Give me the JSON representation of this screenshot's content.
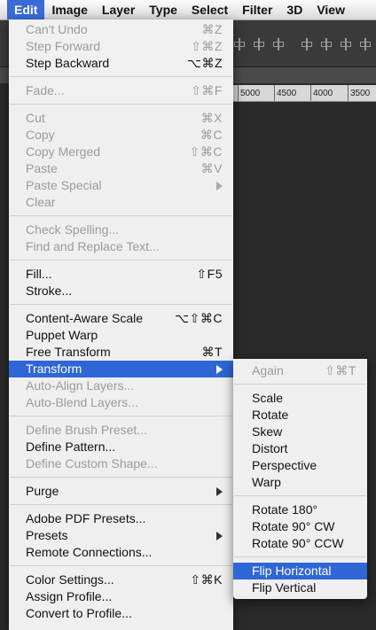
{
  "menubar": {
    "items": [
      {
        "label": "Edit",
        "active": true
      },
      {
        "label": "Image"
      },
      {
        "label": "Layer"
      },
      {
        "label": "Type"
      },
      {
        "label": "Select"
      },
      {
        "label": "Filter"
      },
      {
        "label": "3D"
      },
      {
        "label": "View"
      }
    ]
  },
  "ruler": {
    "marks": [
      "5000",
      "4500",
      "4000",
      "3500"
    ]
  },
  "edit_menu": {
    "groups": [
      [
        {
          "label": "Can't Undo",
          "shortcut": "⌘Z",
          "disabled": true
        },
        {
          "label": "Step Forward",
          "shortcut": "⇧⌘Z",
          "disabled": true
        },
        {
          "label": "Step Backward",
          "shortcut": "⌥⌘Z",
          "disabled": false
        }
      ],
      [
        {
          "label": "Fade...",
          "shortcut": "⇧⌘F",
          "disabled": true
        }
      ],
      [
        {
          "label": "Cut",
          "shortcut": "⌘X",
          "disabled": true
        },
        {
          "label": "Copy",
          "shortcut": "⌘C",
          "disabled": true
        },
        {
          "label": "Copy Merged",
          "shortcut": "⇧⌘C",
          "disabled": true
        },
        {
          "label": "Paste",
          "shortcut": "⌘V",
          "disabled": true
        },
        {
          "label": "Paste Special",
          "submenu": true,
          "disabled": true
        },
        {
          "label": "Clear",
          "disabled": true
        }
      ],
      [
        {
          "label": "Check Spelling...",
          "disabled": true
        },
        {
          "label": "Find and Replace Text...",
          "disabled": true
        }
      ],
      [
        {
          "label": "Fill...",
          "shortcut": "⇧F5",
          "disabled": false
        },
        {
          "label": "Stroke...",
          "disabled": false
        }
      ],
      [
        {
          "label": "Content-Aware Scale",
          "shortcut": "⌥⇧⌘C",
          "disabled": false
        },
        {
          "label": "Puppet Warp",
          "disabled": false
        },
        {
          "label": "Free Transform",
          "shortcut": "⌘T",
          "disabled": false
        },
        {
          "label": "Transform",
          "submenu": true,
          "highlighted": true,
          "disabled": false
        },
        {
          "label": "Auto-Align Layers...",
          "disabled": true
        },
        {
          "label": "Auto-Blend Layers...",
          "disabled": true
        }
      ],
      [
        {
          "label": "Define Brush Preset...",
          "disabled": true
        },
        {
          "label": "Define Pattern...",
          "disabled": false
        },
        {
          "label": "Define Custom Shape...",
          "disabled": true
        }
      ],
      [
        {
          "label": "Purge",
          "submenu": true,
          "disabled": false
        }
      ],
      [
        {
          "label": "Adobe PDF Presets...",
          "disabled": false
        },
        {
          "label": "Presets",
          "submenu": true,
          "disabled": false
        },
        {
          "label": "Remote Connections...",
          "disabled": false
        }
      ],
      [
        {
          "label": "Color Settings...",
          "shortcut": "⇧⌘K",
          "disabled": false
        },
        {
          "label": "Assign Profile...",
          "disabled": false
        },
        {
          "label": "Convert to Profile...",
          "disabled": false
        }
      ]
    ]
  },
  "transform_submenu": {
    "groups": [
      [
        {
          "label": "Again",
          "shortcut": "⇧⌘T",
          "disabled": true
        }
      ],
      [
        {
          "label": "Scale"
        },
        {
          "label": "Rotate"
        },
        {
          "label": "Skew"
        },
        {
          "label": "Distort"
        },
        {
          "label": "Perspective"
        },
        {
          "label": "Warp"
        }
      ],
      [
        {
          "label": "Rotate 180°"
        },
        {
          "label": "Rotate 90° CW"
        },
        {
          "label": "Rotate 90° CCW"
        }
      ],
      [
        {
          "label": "Flip Horizontal",
          "highlighted": true
        },
        {
          "label": "Flip Vertical"
        }
      ]
    ]
  }
}
